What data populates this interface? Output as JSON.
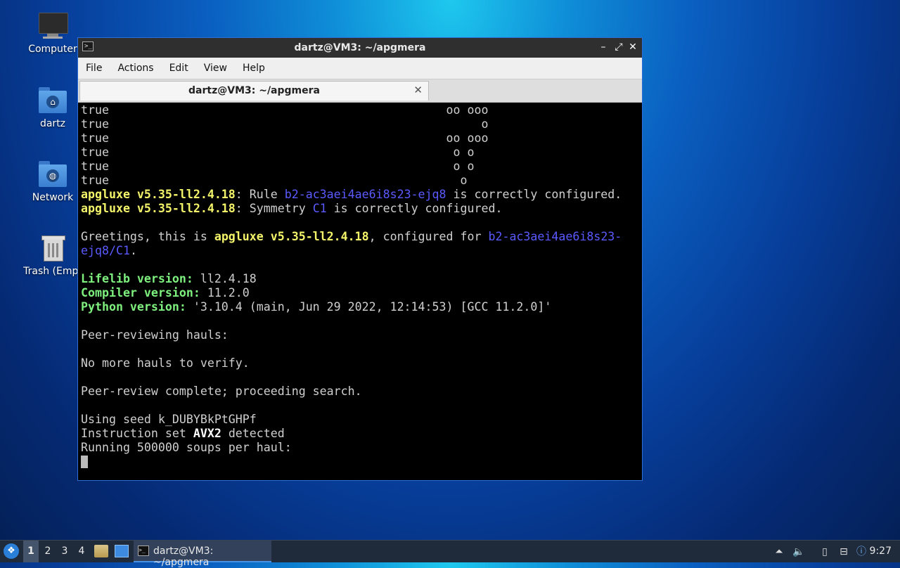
{
  "desktop": {
    "icons": [
      {
        "label": "Computer",
        "icon": "computer-icon"
      },
      {
        "label": "dartz",
        "icon": "home-folder-icon"
      },
      {
        "label": "Network",
        "icon": "network-folder-icon"
      },
      {
        "label": "Trash (Empt",
        "icon": "trash-icon"
      }
    ]
  },
  "window": {
    "title": "dartz@VM3: ~/apgmera",
    "menu": [
      "File",
      "Actions",
      "Edit",
      "View",
      "Help"
    ],
    "tab_label": "dartz@VM3: ~/apgmera",
    "controls": {
      "minimize": "–",
      "maximize": "⤢",
      "close": "✕"
    }
  },
  "terminal": {
    "lines": [
      [
        {
          "t": "true                                                oo ooo"
        }
      ],
      [
        {
          "t": "true                                                     o"
        }
      ],
      [
        {
          "t": "true                                                oo ooo"
        }
      ],
      [
        {
          "t": "true                                                 o o"
        }
      ],
      [
        {
          "t": "true                                                 o o"
        }
      ],
      [
        {
          "t": "true                                                  o"
        }
      ],
      [
        {
          "t": "apgluxe v5.35-ll2.4.18",
          "c": "y"
        },
        {
          "t": ": Rule "
        },
        {
          "t": "b2-ac3aei4ae6i8s23-ejq8",
          "c": "b"
        },
        {
          "t": " is correctly configured."
        }
      ],
      [
        {
          "t": "apgluxe v5.35-ll2.4.18",
          "c": "y"
        },
        {
          "t": ": Symmetry "
        },
        {
          "t": "C1",
          "c": "b"
        },
        {
          "t": " is correctly configured."
        }
      ],
      [
        {
          "t": ""
        }
      ],
      [
        {
          "t": "Greetings, this is "
        },
        {
          "t": "apgluxe v5.35-ll2.4.18",
          "c": "y"
        },
        {
          "t": ", configured for "
        },
        {
          "t": "b2-ac3aei4ae6i8s23-",
          "c": "b"
        }
      ],
      [
        {
          "t": "ejq8/C1",
          "c": "b"
        },
        {
          "t": "."
        }
      ],
      [
        {
          "t": ""
        }
      ],
      [
        {
          "t": "Lifelib version:",
          "c": "g"
        },
        {
          "t": " ll2.4.18"
        }
      ],
      [
        {
          "t": "Compiler version:",
          "c": "g"
        },
        {
          "t": " 11.2.0"
        }
      ],
      [
        {
          "t": "Python version:",
          "c": "g"
        },
        {
          "t": " '3.10.4 (main, Jun 29 2022, 12:14:53) [GCC 11.2.0]'"
        }
      ],
      [
        {
          "t": ""
        }
      ],
      [
        {
          "t": "Peer-reviewing hauls:"
        }
      ],
      [
        {
          "t": ""
        }
      ],
      [
        {
          "t": "No more hauls to verify."
        }
      ],
      [
        {
          "t": ""
        }
      ],
      [
        {
          "t": "Peer-review complete; proceeding search."
        }
      ],
      [
        {
          "t": ""
        }
      ],
      [
        {
          "t": "Using seed k_DUBYBkPtGHPf"
        }
      ],
      [
        {
          "t": "Instruction set "
        },
        {
          "t": "AVX2",
          "c": "w"
        },
        {
          "t": " detected"
        }
      ],
      [
        {
          "t": "Running 500000 soups per haul:"
        }
      ]
    ]
  },
  "taskbar": {
    "workspaces": [
      "1",
      "2",
      "3",
      "4"
    ],
    "active_workspace": "1",
    "task_label": "dartz@VM3: ~/apgmera",
    "clock": "9:27"
  }
}
